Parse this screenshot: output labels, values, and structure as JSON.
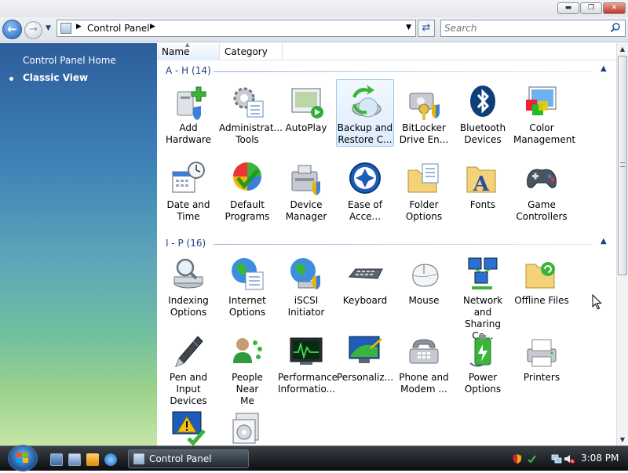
{
  "window": {
    "caption_buttons": {
      "minimize": "▬",
      "maximize": "❐",
      "close": "✕"
    }
  },
  "nav": {
    "address_text": "Control Panel",
    "search_placeholder": "Search"
  },
  "sidebar": {
    "home_link": "Control Panel Home",
    "classic_view": "Classic View"
  },
  "columns": {
    "name": "Name",
    "category": "Category"
  },
  "groups": [
    {
      "label": "A - H (14)",
      "items": [
        {
          "l1": "Add",
          "l2": "Hardware",
          "icon": "add-hardware-icon"
        },
        {
          "l1": "Administrat...",
          "l2": "Tools",
          "icon": "administrative-tools-icon"
        },
        {
          "l1": "AutoPlay",
          "l2": "",
          "icon": "autoplay-icon"
        },
        {
          "l1": "Backup and",
          "l2": "Restore C...",
          "icon": "backup-restore-icon"
        },
        {
          "l1": "BitLocker",
          "l2": "Drive En...",
          "icon": "bitlocker-icon"
        },
        {
          "l1": "Bluetooth",
          "l2": "Devices",
          "icon": "bluetooth-icon"
        },
        {
          "l1": "Color",
          "l2": "Management",
          "icon": "color-management-icon"
        },
        {
          "l1": "Date and",
          "l2": "Time",
          "icon": "date-time-icon"
        },
        {
          "l1": "Default",
          "l2": "Programs",
          "icon": "default-programs-icon"
        },
        {
          "l1": "Device",
          "l2": "Manager",
          "icon": "device-manager-icon"
        },
        {
          "l1": "Ease of",
          "l2": "Acce...",
          "icon": "ease-of-access-icon"
        },
        {
          "l1": "Folder",
          "l2": "Options",
          "icon": "folder-options-icon"
        },
        {
          "l1": "Fonts",
          "l2": "",
          "icon": "fonts-icon"
        },
        {
          "l1": "Game",
          "l2": "Controllers",
          "icon": "game-controllers-icon"
        }
      ]
    },
    {
      "label": "I - P (16)",
      "items": [
        {
          "l1": "Indexing",
          "l2": "Options",
          "icon": "indexing-options-icon"
        },
        {
          "l1": "Internet",
          "l2": "Options",
          "icon": "internet-options-icon"
        },
        {
          "l1": "iSCSI Initiator",
          "l2": "",
          "icon": "iscsi-initiator-icon"
        },
        {
          "l1": "Keyboard",
          "l2": "",
          "icon": "keyboard-icon"
        },
        {
          "l1": "Mouse",
          "l2": "",
          "icon": "mouse-icon"
        },
        {
          "l1": "Network and",
          "l2": "Sharing Ce...",
          "icon": "network-sharing-icon"
        },
        {
          "l1": "Offline Files",
          "l2": "",
          "icon": "offline-files-icon"
        },
        {
          "l1": "Pen and",
          "l2": "Input Devices",
          "icon": "pen-input-icon"
        },
        {
          "l1": "People Near",
          "l2": "Me",
          "icon": "people-near-me-icon"
        },
        {
          "l1": "Performance",
          "l2": "Informatio...",
          "icon": "performance-icon"
        },
        {
          "l1": "Personaliz...",
          "l2": "",
          "icon": "personalization-icon"
        },
        {
          "l1": "Phone and",
          "l2": "Modem ...",
          "icon": "phone-modem-icon"
        },
        {
          "l1": "Power",
          "l2": "Options",
          "icon": "power-options-icon"
        },
        {
          "l1": "Printers",
          "l2": "",
          "icon": "printers-icon"
        },
        {
          "l1": "",
          "l2": "",
          "icon": "problem-reports-icon"
        },
        {
          "l1": "",
          "l2": "",
          "icon": "programs-features-icon"
        }
      ]
    }
  ],
  "taskbar": {
    "task_label": "Control Panel",
    "clock": "3:08 PM"
  }
}
